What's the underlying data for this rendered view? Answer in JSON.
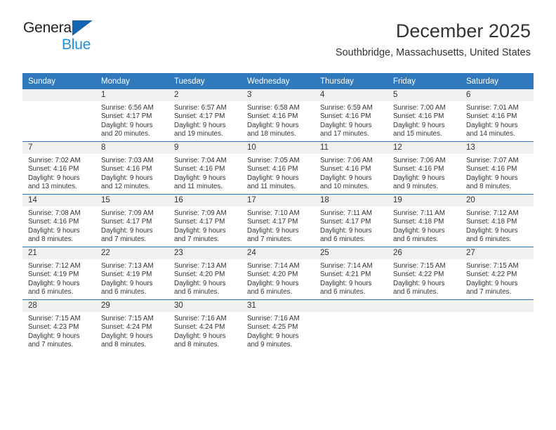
{
  "logo": {
    "word_top": "General",
    "word_bottom": "Blue",
    "triangle_color": "#1565b0",
    "blue_color": "#1f8fe0"
  },
  "header": {
    "title": "December 2025",
    "subtitle": "Southbridge, Massachusetts, United States"
  },
  "theme": {
    "header_bg": "#3179bd",
    "daynum_bg": "#f0f0f0",
    "separator": "#2d74b8"
  },
  "calendar": {
    "weekday_headers": [
      "Sunday",
      "Monday",
      "Tuesday",
      "Wednesday",
      "Thursday",
      "Friday",
      "Saturday"
    ],
    "weeks": [
      [
        {
          "day": "",
          "lines": []
        },
        {
          "day": "1",
          "lines": [
            "Sunrise: 6:56 AM",
            "Sunset: 4:17 PM",
            "Daylight: 9 hours",
            "and 20 minutes."
          ]
        },
        {
          "day": "2",
          "lines": [
            "Sunrise: 6:57 AM",
            "Sunset: 4:17 PM",
            "Daylight: 9 hours",
            "and 19 minutes."
          ]
        },
        {
          "day": "3",
          "lines": [
            "Sunrise: 6:58 AM",
            "Sunset: 4:16 PM",
            "Daylight: 9 hours",
            "and 18 minutes."
          ]
        },
        {
          "day": "4",
          "lines": [
            "Sunrise: 6:59 AM",
            "Sunset: 4:16 PM",
            "Daylight: 9 hours",
            "and 17 minutes."
          ]
        },
        {
          "day": "5",
          "lines": [
            "Sunrise: 7:00 AM",
            "Sunset: 4:16 PM",
            "Daylight: 9 hours",
            "and 15 minutes."
          ]
        },
        {
          "day": "6",
          "lines": [
            "Sunrise: 7:01 AM",
            "Sunset: 4:16 PM",
            "Daylight: 9 hours",
            "and 14 minutes."
          ]
        }
      ],
      [
        {
          "day": "7",
          "lines": [
            "Sunrise: 7:02 AM",
            "Sunset: 4:16 PM",
            "Daylight: 9 hours",
            "and 13 minutes."
          ]
        },
        {
          "day": "8",
          "lines": [
            "Sunrise: 7:03 AM",
            "Sunset: 4:16 PM",
            "Daylight: 9 hours",
            "and 12 minutes."
          ]
        },
        {
          "day": "9",
          "lines": [
            "Sunrise: 7:04 AM",
            "Sunset: 4:16 PM",
            "Daylight: 9 hours",
            "and 11 minutes."
          ]
        },
        {
          "day": "10",
          "lines": [
            "Sunrise: 7:05 AM",
            "Sunset: 4:16 PM",
            "Daylight: 9 hours",
            "and 11 minutes."
          ]
        },
        {
          "day": "11",
          "lines": [
            "Sunrise: 7:06 AM",
            "Sunset: 4:16 PM",
            "Daylight: 9 hours",
            "and 10 minutes."
          ]
        },
        {
          "day": "12",
          "lines": [
            "Sunrise: 7:06 AM",
            "Sunset: 4:16 PM",
            "Daylight: 9 hours",
            "and 9 minutes."
          ]
        },
        {
          "day": "13",
          "lines": [
            "Sunrise: 7:07 AM",
            "Sunset: 4:16 PM",
            "Daylight: 9 hours",
            "and 8 minutes."
          ]
        }
      ],
      [
        {
          "day": "14",
          "lines": [
            "Sunrise: 7:08 AM",
            "Sunset: 4:16 PM",
            "Daylight: 9 hours",
            "and 8 minutes."
          ]
        },
        {
          "day": "15",
          "lines": [
            "Sunrise: 7:09 AM",
            "Sunset: 4:17 PM",
            "Daylight: 9 hours",
            "and 7 minutes."
          ]
        },
        {
          "day": "16",
          "lines": [
            "Sunrise: 7:09 AM",
            "Sunset: 4:17 PM",
            "Daylight: 9 hours",
            "and 7 minutes."
          ]
        },
        {
          "day": "17",
          "lines": [
            "Sunrise: 7:10 AM",
            "Sunset: 4:17 PM",
            "Daylight: 9 hours",
            "and 7 minutes."
          ]
        },
        {
          "day": "18",
          "lines": [
            "Sunrise: 7:11 AM",
            "Sunset: 4:17 PM",
            "Daylight: 9 hours",
            "and 6 minutes."
          ]
        },
        {
          "day": "19",
          "lines": [
            "Sunrise: 7:11 AM",
            "Sunset: 4:18 PM",
            "Daylight: 9 hours",
            "and 6 minutes."
          ]
        },
        {
          "day": "20",
          "lines": [
            "Sunrise: 7:12 AM",
            "Sunset: 4:18 PM",
            "Daylight: 9 hours",
            "and 6 minutes."
          ]
        }
      ],
      [
        {
          "day": "21",
          "lines": [
            "Sunrise: 7:12 AM",
            "Sunset: 4:19 PM",
            "Daylight: 9 hours",
            "and 6 minutes."
          ]
        },
        {
          "day": "22",
          "lines": [
            "Sunrise: 7:13 AM",
            "Sunset: 4:19 PM",
            "Daylight: 9 hours",
            "and 6 minutes."
          ]
        },
        {
          "day": "23",
          "lines": [
            "Sunrise: 7:13 AM",
            "Sunset: 4:20 PM",
            "Daylight: 9 hours",
            "and 6 minutes."
          ]
        },
        {
          "day": "24",
          "lines": [
            "Sunrise: 7:14 AM",
            "Sunset: 4:20 PM",
            "Daylight: 9 hours",
            "and 6 minutes."
          ]
        },
        {
          "day": "25",
          "lines": [
            "Sunrise: 7:14 AM",
            "Sunset: 4:21 PM",
            "Daylight: 9 hours",
            "and 6 minutes."
          ]
        },
        {
          "day": "26",
          "lines": [
            "Sunrise: 7:15 AM",
            "Sunset: 4:22 PM",
            "Daylight: 9 hours",
            "and 6 minutes."
          ]
        },
        {
          "day": "27",
          "lines": [
            "Sunrise: 7:15 AM",
            "Sunset: 4:22 PM",
            "Daylight: 9 hours",
            "and 7 minutes."
          ]
        }
      ],
      [
        {
          "day": "28",
          "lines": [
            "Sunrise: 7:15 AM",
            "Sunset: 4:23 PM",
            "Daylight: 9 hours",
            "and 7 minutes."
          ]
        },
        {
          "day": "29",
          "lines": [
            "Sunrise: 7:15 AM",
            "Sunset: 4:24 PM",
            "Daylight: 9 hours",
            "and 8 minutes."
          ]
        },
        {
          "day": "30",
          "lines": [
            "Sunrise: 7:16 AM",
            "Sunset: 4:24 PM",
            "Daylight: 9 hours",
            "and 8 minutes."
          ]
        },
        {
          "day": "31",
          "lines": [
            "Sunrise: 7:16 AM",
            "Sunset: 4:25 PM",
            "Daylight: 9 hours",
            "and 9 minutes."
          ]
        },
        {
          "day": "",
          "lines": []
        },
        {
          "day": "",
          "lines": []
        },
        {
          "day": "",
          "lines": []
        }
      ]
    ]
  }
}
